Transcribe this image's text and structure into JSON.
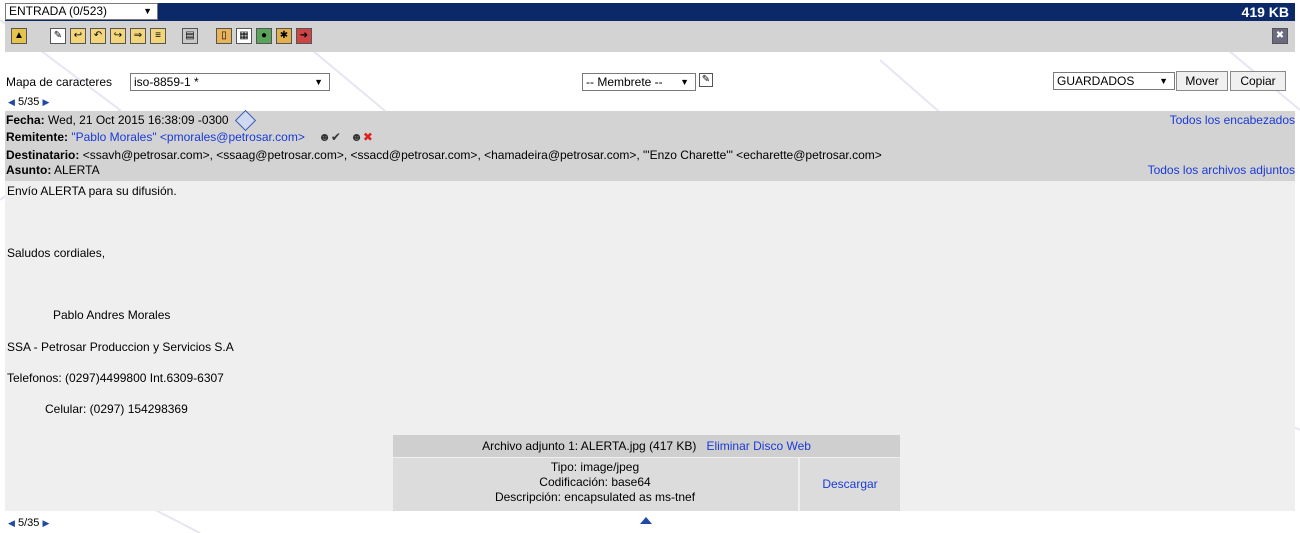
{
  "top_bar": {
    "folder_select": "ENTRADA (0/523)",
    "mailbox_size": "419 KB"
  },
  "toolbar": {
    "icons": [
      "folder-up-icon",
      "new-message-icon",
      "reply-icon",
      "reply-all-icon",
      "forward-icon",
      "forward-attachment-icon",
      "redirect-icon",
      "print-icon",
      "address-book-icon",
      "calendar-icon",
      "color-wheel-icon",
      "filter-icon",
      "exit-icon"
    ],
    "trash_icon": "trash-icon"
  },
  "charset_row": {
    "label": "Mapa de caracteres",
    "charset_value": "iso-8859-1 *",
    "letterhead_value": "-- Membrete --",
    "folder_target": "GUARDADOS",
    "move_label": "Mover",
    "copy_label": "Copiar"
  },
  "pager_top": "5/35",
  "pager_bottom": "5/35",
  "header": {
    "date_label": "Fecha:",
    "date_value": "Wed, 21 Oct 2015 16:38:09 -0300",
    "from_label": "Remitente:",
    "from_value": "\"Pablo Morales\" <pmorales@petrosar.com>",
    "to_label": "Destinatario:",
    "to_value": "<ssavh@petrosar.com>, <ssaag@petrosar.com>, <ssacd@petrosar.com>, <hamadeira@petrosar.com>, \"'Enzo Charette'\" <echarette@petrosar.com>",
    "subject_label": "Asunto:",
    "subject_value": "ALERTA",
    "all_headers_link": "Todos los encabezados",
    "all_attachments_link": "Todos los archivos adjuntos"
  },
  "body": {
    "lines": [
      "Envío ALERTA para su difusión.",
      "Saludos cordiales,",
      "Pablo Andres Morales",
      "SSA - Petrosar Produccion y Servicios S.A",
      "Telefonos: (0297)4499800 Int.6309-6307",
      "Celular: (0297) 154298369"
    ]
  },
  "attachment": {
    "title": "Archivo adjunto 1: ALERTA.jpg (417 KB)",
    "delete_link": "Eliminar",
    "webdisk_link": "Disco Web",
    "type": "Tipo: image/jpeg",
    "encoding": "Codificación: base64",
    "description": "Descripción: encapsulated as ms-tnef",
    "download_link": "Descargar"
  },
  "colors": {
    "top_bar": "#0b2868",
    "header_bg": "#d3d3d3",
    "body_bg": "#efefef",
    "link": "#1a3ad8"
  }
}
